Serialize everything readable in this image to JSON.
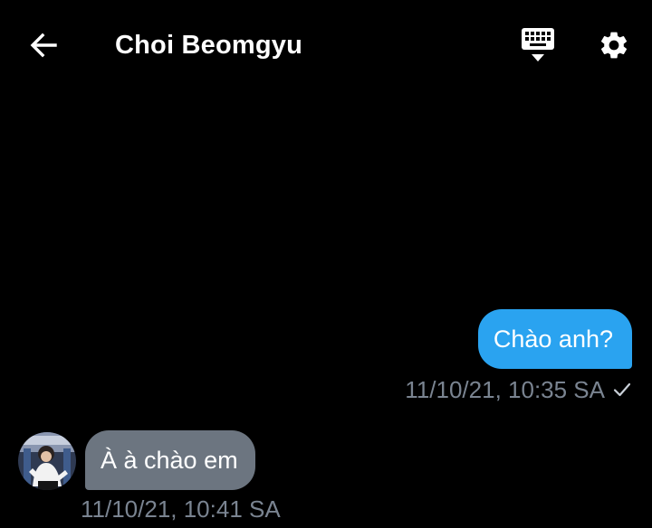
{
  "header": {
    "title": "Choi Beomgyu",
    "back_icon": "arrow-left-icon",
    "keyboard_icon": "keyboard-hide-icon",
    "settings_icon": "gear-icon"
  },
  "messages": [
    {
      "direction": "outgoing",
      "text": "Chào anh?",
      "timestamp": "11/10/21, 10:35 SA",
      "status_icon": "check-icon"
    },
    {
      "direction": "incoming",
      "text": "À à chào em",
      "timestamp": "11/10/21, 10:41 SA",
      "avatar_icon": "avatar"
    }
  ],
  "colors": {
    "background": "#000000",
    "outgoing_bubble": "#2aa3f0",
    "incoming_bubble": "#6c7580",
    "timestamp": "#7a8491",
    "text": "#ffffff"
  }
}
